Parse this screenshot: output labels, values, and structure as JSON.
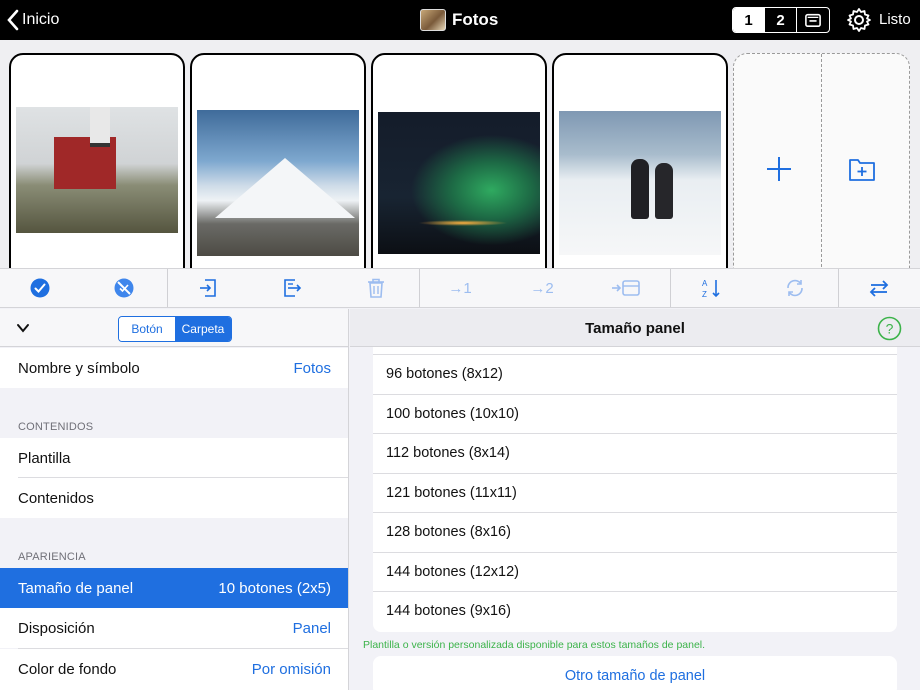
{
  "topbar": {
    "back_label": "Inicio",
    "title": "Fotos",
    "pages": [
      "1",
      "2"
    ],
    "selected_page": "1",
    "done_label": "Listo"
  },
  "tiles": [
    {
      "name": "church",
      "selected": false
    },
    {
      "name": "mountain",
      "selected": false
    },
    {
      "name": "aurora",
      "selected": false
    },
    {
      "name": "snow-hikers",
      "selected": false
    }
  ],
  "toolbar": {
    "items": [
      {
        "icon": "select-all-icon"
      },
      {
        "icon": "deselect-icon"
      },
      {
        "icon": "import-icon"
      },
      {
        "icon": "export-icon"
      },
      {
        "icon": "trash-icon"
      },
      {
        "icon": "move-to-page-1-icon",
        "label": "1"
      },
      {
        "icon": "move-to-page-2-icon",
        "label": "2"
      },
      {
        "icon": "move-to-folder-icon"
      },
      {
        "icon": "sort-az-icon"
      },
      {
        "icon": "refresh-icon"
      },
      {
        "icon": "swap-icon"
      }
    ]
  },
  "left": {
    "segment": {
      "options": [
        "Botón",
        "Carpeta"
      ],
      "selected": "Carpeta"
    },
    "name_row": {
      "label": "Nombre y símbolo",
      "value": "Fotos"
    },
    "contents_section": "CONTENIDOS",
    "template_row": {
      "label": "Plantilla"
    },
    "contents_row": {
      "label": "Contenidos"
    },
    "appearance_section": "APARIENCIA",
    "panel_size_row": {
      "label": "Tamaño de panel",
      "value": "10 botones (2x5)"
    },
    "layout_row": {
      "label": "Disposición",
      "value": "Panel"
    },
    "bg_row": {
      "label": "Color de fondo",
      "value": "Por omisión"
    }
  },
  "right": {
    "title": "Tamaño panel",
    "options": [
      "96 botones (8x12)",
      "100 botones (10x10)",
      "112 botones (8x14)",
      "121 botones (11x11)",
      "128 botones (8x16)",
      "144 botones (12x12)",
      "144 botones (9x16)"
    ],
    "note": "Plantilla o versión personalizada disponible para estos tamaños de panel.",
    "other_label": "Otro tamaño de panel"
  },
  "colors": {
    "accent": "#1f6fe0",
    "topbar": "#000000",
    "note": "#3cb34a",
    "help": "#3cb34a"
  }
}
